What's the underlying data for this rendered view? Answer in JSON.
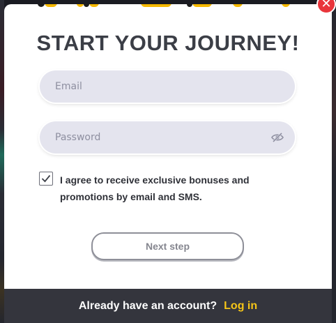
{
  "modal": {
    "title": "START YOUR JOURNEY!",
    "close_icon": "x-icon"
  },
  "form": {
    "email": {
      "placeholder": "Email",
      "value": ""
    },
    "password": {
      "placeholder": "Password",
      "value": "",
      "toggle_icon": "eye-slash-icon"
    },
    "consent": {
      "checked": true,
      "label": "I agree to receive exclusive bonuses and promotions by email and SMS."
    },
    "next_label": "Next step"
  },
  "footer": {
    "question": "Already have an account?",
    "login_label": "Log in"
  },
  "colors": {
    "accent": "#f5c518",
    "close": "#e9353b",
    "footer_bg": "#34353d",
    "field_bg": "#e4e4ee"
  }
}
